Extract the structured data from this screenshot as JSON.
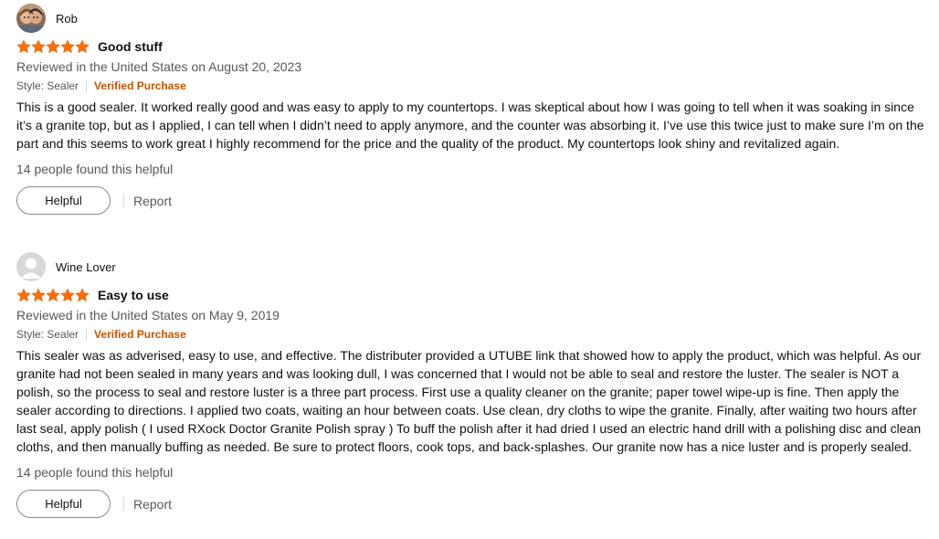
{
  "colors": {
    "star": "#ff6f00",
    "verified": "#c45500",
    "muted_text": "#565959",
    "body_text": "#0f1111"
  },
  "reviews": [
    {
      "profile_name": "Rob",
      "avatar": "profile-photo",
      "rating_stars": 5,
      "title": "Good stuff",
      "date_line": "Reviewed in the United States on August 20, 2023",
      "style": "Style: Sealer",
      "verified": "Verified Purchase",
      "body": "This is a good sealer. It worked really good and was easy to apply to my countertops. I was skeptical about how I was going to tell when it was soaking in since it’s a granite top, but as I applied, I can tell when I didn’t need to apply anymore, and the counter was absorbing it. I’ve use this twice just to make sure I’m on the part and this seems to work great I highly recommend for the price and the quality of the product. My countertops look shiny and revitalized again.",
      "helpful_count": "14 people found this helpful",
      "helpful_label": "Helpful",
      "report_label": "Report"
    },
    {
      "profile_name": "Wine Lover",
      "avatar": "default-user-icon",
      "rating_stars": 5,
      "title": "Easy to use",
      "date_line": "Reviewed in the United States on May 9, 2019",
      "style": "Style: Sealer",
      "verified": "Verified Purchase",
      "body": "This sealer was as adverised, easy to use, and effective. The distributer provided a UTUBE link that showed how to apply the product, which was helpful. As our granite had not been sealed in many years and was looking dull, I was concerned that I would not be able to seal and restore the luster. The sealer is NOT a polish, so the process to seal and restore luster is a three part process. First use a quality cleaner on the granite; paper towel wipe-up is fine. Then apply the sealer according to directions. I applied two coats, waiting an hour between coats. Use clean, dry cloths to wipe the granite. Finally, after waiting two hours after last seal, apply polish ( I used RXock Doctor Granite Polish spray ) To buff the polish after it had dried I used an electric hand drill with a polishing disc and clean cloths, and then manually buffing as needed. Be sure to protect floors, cook tops, and back-splashes. Our granite now has a nice luster and is properly sealed.",
      "helpful_count": "14 people found this helpful",
      "helpful_label": "Helpful",
      "report_label": "Report"
    }
  ]
}
